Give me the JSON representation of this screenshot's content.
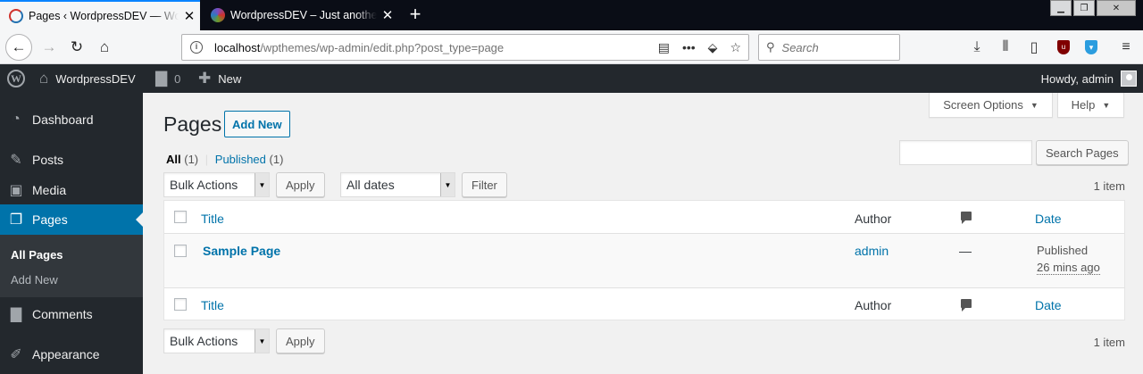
{
  "browser": {
    "tabs": [
      {
        "title": "Pages ‹ WordpressDEV — WordPress",
        "active": true
      },
      {
        "title": "WordpressDEV – Just another WordPress site",
        "active": false
      }
    ],
    "url_host": "localhost",
    "url_path": "/wpthemes/wp-admin/edit.php?post_type=page",
    "search_placeholder": "Search",
    "url_icons": {
      "reader": "▤",
      "more": "•••",
      "pocket": "⬙",
      "bookmark": "☆"
    },
    "toolbar_icons": [
      "download-icon",
      "library-icon",
      "sidebar-icon",
      "ublock-icon",
      "shield-icon",
      "menu-icon"
    ]
  },
  "adminbar": {
    "site_name": "WordpressDEV",
    "comments_count": "0",
    "new_label": "New",
    "howdy": "Howdy, admin"
  },
  "sidebar": {
    "items": [
      {
        "label": "Dashboard",
        "icon": "dashboard-icon"
      },
      {
        "label": "Posts",
        "icon": "pin-icon"
      },
      {
        "label": "Media",
        "icon": "media-icon"
      },
      {
        "label": "Pages",
        "icon": "pages-icon",
        "current": true
      },
      {
        "label": "Comments",
        "icon": "comment-icon"
      },
      {
        "label": "Appearance",
        "icon": "brush-icon"
      }
    ],
    "submenu": [
      {
        "label": "All Pages",
        "current": true
      },
      {
        "label": "Add New"
      }
    ]
  },
  "content": {
    "screen_options": "Screen Options",
    "help": "Help",
    "page_title": "Pages",
    "add_new": "Add New",
    "views": {
      "all_label": "All",
      "all_count": "(1)",
      "separator": "|",
      "published_label": "Published",
      "published_count": "(1)"
    },
    "search_button": "Search Pages",
    "bulk_actions": "Bulk Actions",
    "apply": "Apply",
    "all_dates": "All dates",
    "filter": "Filter",
    "item_count": "1 item",
    "table": {
      "columns": {
        "title": "Title",
        "author": "Author",
        "date": "Date"
      },
      "rows": [
        {
          "title": "Sample Page",
          "author": "admin",
          "comments": "—",
          "status": "Published",
          "date": "26 mins ago"
        }
      ]
    }
  },
  "colors": {
    "accent": "#0073aa",
    "adminbar_bg": "#23282d",
    "content_bg": "#f1f1f1"
  }
}
